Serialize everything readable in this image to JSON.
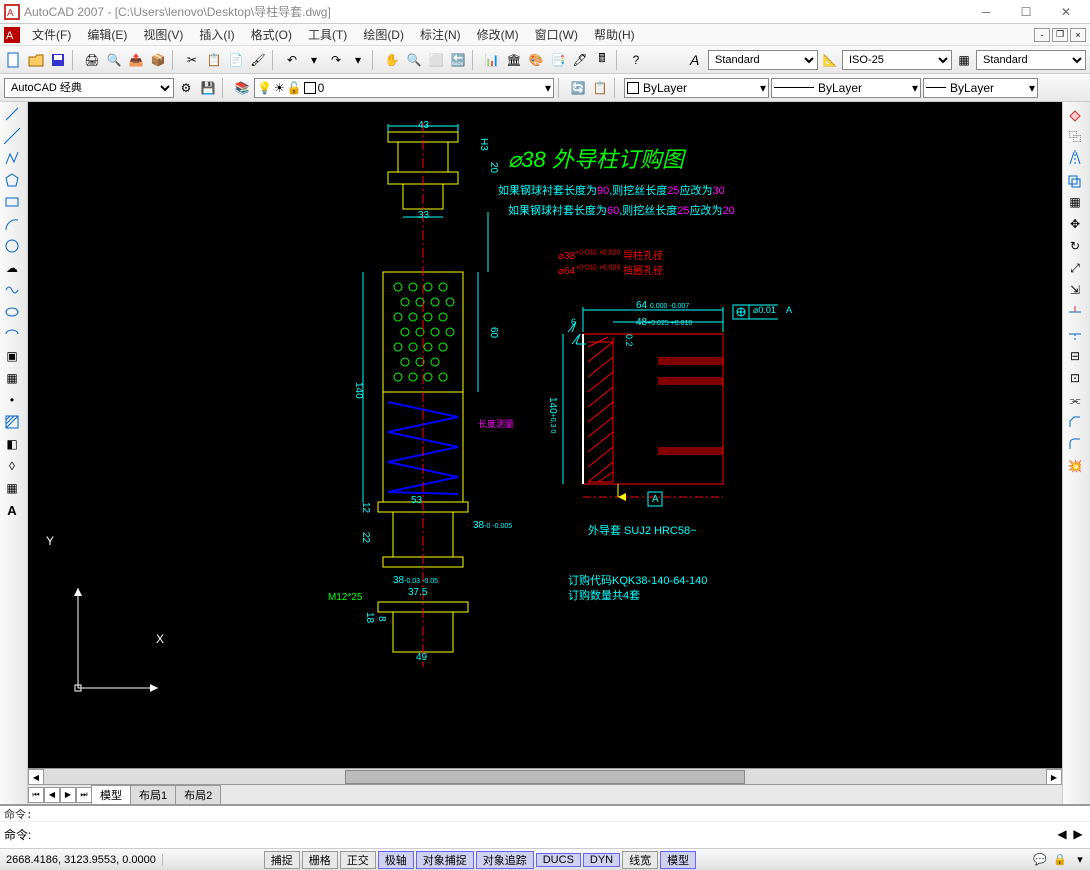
{
  "app": {
    "title": "AutoCAD 2007 - [C:\\Users\\lenovo\\Desktop\\导柱导套.dwg]"
  },
  "menu": [
    "文件(F)",
    "编辑(E)",
    "视图(V)",
    "插入(I)",
    "格式(O)",
    "工具(T)",
    "绘图(D)",
    "标注(N)",
    "修改(M)",
    "窗口(W)",
    "帮助(H)"
  ],
  "styles": {
    "textstyle": "Standard",
    "dimstyle": "ISO-25",
    "tablestyle": "Standard"
  },
  "workspace": "AutoCAD 经典",
  "layer": {
    "current": "0"
  },
  "props": {
    "color": "ByLayer",
    "linetype": "ByLayer",
    "lineweight": "ByLayer"
  },
  "tabs": {
    "active": "模型",
    "others": [
      "布局1",
      "布局2"
    ]
  },
  "cmd": {
    "prompt": "命令:",
    "history": "命令:"
  },
  "status": {
    "coords": "2668.4186, 3123.9553, 0.0000",
    "toggles": [
      "捕捉",
      "栅格",
      "正交",
      "极轴",
      "对象捕捉",
      "对象追踪",
      "DUCS",
      "DYN",
      "线宽",
      "模型"
    ]
  },
  "drawing": {
    "title": "⌀38 外导柱订购图",
    "note1a": "如果钢球衬套长度为",
    "note1b": "90",
    "note1c": ",则挖丝长度",
    "note1d": "25",
    "note1e": "应改为",
    "note1f": "30",
    "note2a": "如果钢球衬套长度为",
    "note2b": "60",
    "note2c": ",则挖丝长度",
    "note2d": "25",
    "note2e": "应改为",
    "note2f": "20",
    "red1": "⌀38",
    "red1t": "+0.032 +0.020",
    "red1s": "导柱孔径",
    "red2": "⌀64",
    "red2t": "+0.032 +0.020",
    "red2s": "挡圈孔径",
    "d43": "43",
    "dH3": "H3",
    "d20": "20",
    "d33": "33",
    "d140": "140",
    "d60": "60",
    "d12": "12",
    "d22": "22",
    "d53": "53",
    "d38t": "38",
    "d38tol": "-0 -0.005",
    "d38b": "38",
    "d38btol": "-0.03 -0.05",
    "d375": "37.5",
    "d18": "18",
    "d8": "8",
    "d49": "49",
    "m12": "M12*25",
    "spring": "长度测量",
    "d64": "64",
    "d64tol": "0.000 -0.007",
    "d48": "48",
    "d48tol": "+0.025 +0.010",
    "d02": "0.2",
    "d140r": "140",
    "d140rtol": "+0.3 0",
    "roughness": "6",
    "datumA": "A",
    "gtol": "⌀0.01",
    "gtolA": "A",
    "mat": "外导套 SUJ2 HRC58~",
    "code": "订购代码KQK38-140-64-140",
    "qty": "订购数量共4套",
    "x": "X",
    "y": "Y"
  }
}
